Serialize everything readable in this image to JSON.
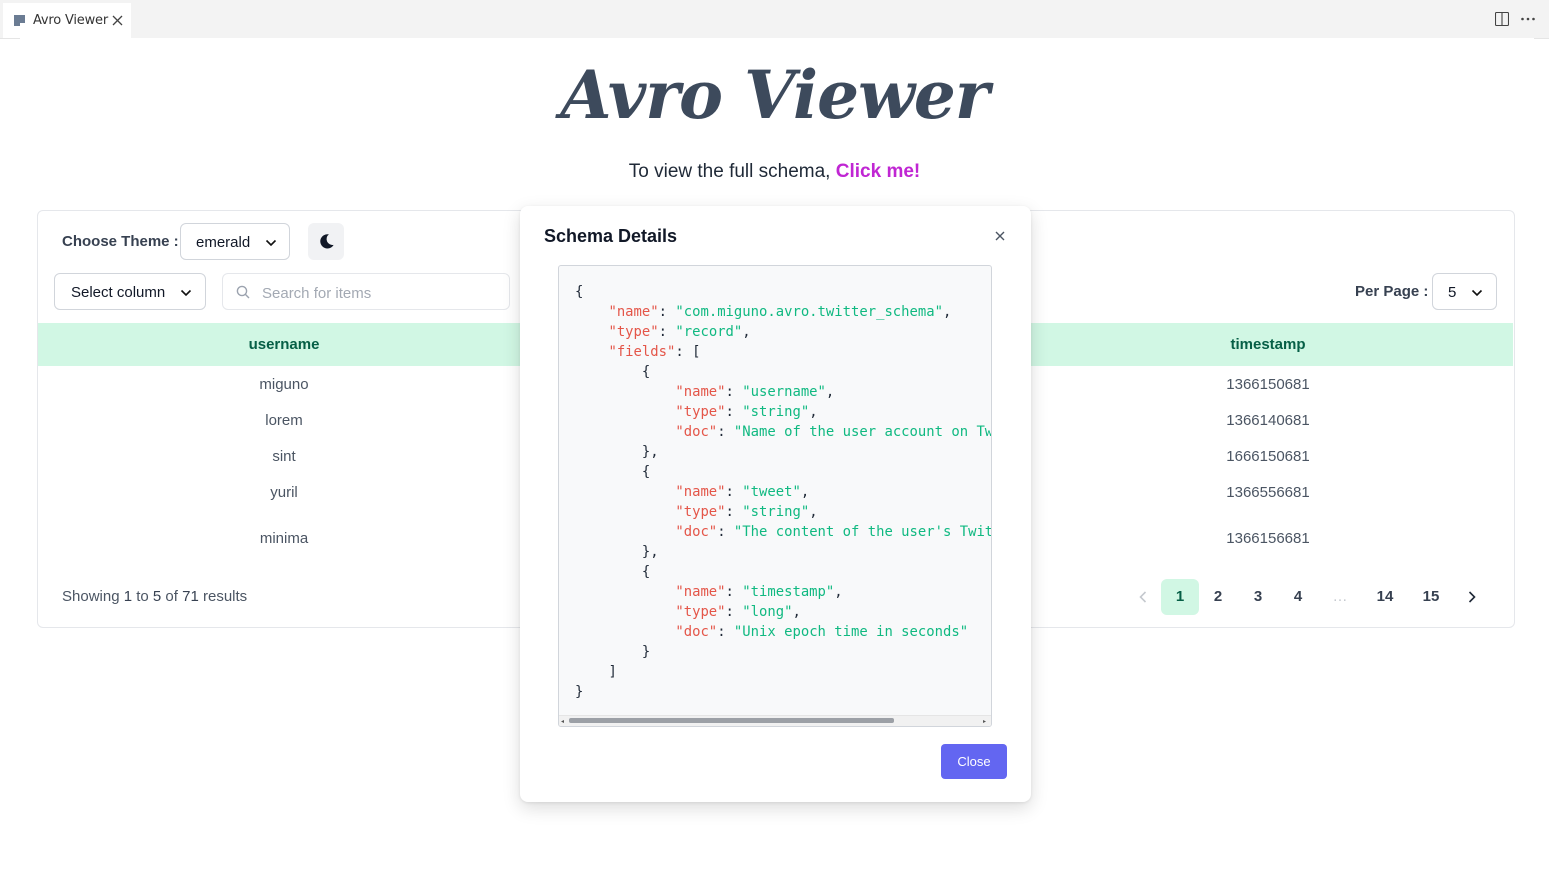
{
  "editor": {
    "tab_title": "Avro Viewer",
    "icons": [
      "file-preview-icon",
      "close-icon",
      "split-editor-icon",
      "more-actions-icon"
    ]
  },
  "page": {
    "title": "Avro Viewer",
    "subtitle_text": "To view the full schema, ",
    "subtitle_link": "Click me!",
    "link_color": "#c026d3"
  },
  "controls": {
    "theme_label": "Choose Theme :",
    "theme_value": "emerald",
    "column_select": "Select column",
    "search_placeholder": "Search for items",
    "per_page_label": "Per Page :",
    "per_page_value": "5"
  },
  "table": {
    "columns": [
      "username",
      "timestamp"
    ],
    "rows": [
      {
        "username": "miguno",
        "timestamp": "1366150681"
      },
      {
        "username": "lorem",
        "timestamp": "1366140681"
      },
      {
        "username": "sint",
        "timestamp": "1666150681"
      },
      {
        "username": "yuril",
        "timestamp": "1366556681"
      },
      {
        "username": "minima",
        "timestamp": "1366156681"
      }
    ],
    "header_bg": "#d1f7e4"
  },
  "footer": {
    "showing_prefix": "Showing ",
    "from": "1",
    "to_word": " to ",
    "to": "5",
    "of_word": " of ",
    "total": "71",
    "suffix": " results"
  },
  "pagination": {
    "pages": [
      "1",
      "2",
      "3",
      "4",
      "…",
      "14",
      "15"
    ],
    "active": "1"
  },
  "modal": {
    "title": "Schema Details",
    "close_label": "Close",
    "button_color": "#6366f1",
    "schema_lines": [
      [
        [
          "p",
          "{"
        ]
      ],
      [
        [
          "p",
          "    "
        ],
        [
          "k",
          "\"name\""
        ],
        [
          "p",
          ": "
        ],
        [
          "s",
          "\"com.miguno.avro.twitter_schema\""
        ],
        [
          "p",
          ","
        ]
      ],
      [
        [
          "p",
          "    "
        ],
        [
          "k",
          "\"type\""
        ],
        [
          "p",
          ": "
        ],
        [
          "s",
          "\"record\""
        ],
        [
          "p",
          ","
        ]
      ],
      [
        [
          "p",
          "    "
        ],
        [
          "k",
          "\"fields\""
        ],
        [
          "p",
          ": ["
        ]
      ],
      [
        [
          "p",
          "        {"
        ]
      ],
      [
        [
          "p",
          "            "
        ],
        [
          "k",
          "\"name\""
        ],
        [
          "p",
          ": "
        ],
        [
          "s",
          "\"username\""
        ],
        [
          "p",
          ","
        ]
      ],
      [
        [
          "p",
          "            "
        ],
        [
          "k",
          "\"type\""
        ],
        [
          "p",
          ": "
        ],
        [
          "s",
          "\"string\""
        ],
        [
          "p",
          ","
        ]
      ],
      [
        [
          "p",
          "            "
        ],
        [
          "k",
          "\"doc\""
        ],
        [
          "p",
          ": "
        ],
        [
          "s",
          "\"Name of the user account on Twitter.com\""
        ]
      ],
      [
        [
          "p",
          "        },"
        ]
      ],
      [
        [
          "p",
          "        {"
        ]
      ],
      [
        [
          "p",
          "            "
        ],
        [
          "k",
          "\"name\""
        ],
        [
          "p",
          ": "
        ],
        [
          "s",
          "\"tweet\""
        ],
        [
          "p",
          ","
        ]
      ],
      [
        [
          "p",
          "            "
        ],
        [
          "k",
          "\"type\""
        ],
        [
          "p",
          ": "
        ],
        [
          "s",
          "\"string\""
        ],
        [
          "p",
          ","
        ]
      ],
      [
        [
          "p",
          "            "
        ],
        [
          "k",
          "\"doc\""
        ],
        [
          "p",
          ": "
        ],
        [
          "s",
          "\"The content of the user's Twitter message\""
        ]
      ],
      [
        [
          "p",
          "        },"
        ]
      ],
      [
        [
          "p",
          "        {"
        ]
      ],
      [
        [
          "p",
          "            "
        ],
        [
          "k",
          "\"name\""
        ],
        [
          "p",
          ": "
        ],
        [
          "s",
          "\"timestamp\""
        ],
        [
          "p",
          ","
        ]
      ],
      [
        [
          "p",
          "            "
        ],
        [
          "k",
          "\"type\""
        ],
        [
          "p",
          ": "
        ],
        [
          "s",
          "\"long\""
        ],
        [
          "p",
          ","
        ]
      ],
      [
        [
          "p",
          "            "
        ],
        [
          "k",
          "\"doc\""
        ],
        [
          "p",
          ": "
        ],
        [
          "s",
          "\"Unix epoch time in seconds\""
        ]
      ],
      [
        [
          "p",
          "        }"
        ]
      ],
      [
        [
          "p",
          "    ]"
        ]
      ],
      [
        [
          "p",
          "}"
        ]
      ]
    ]
  }
}
